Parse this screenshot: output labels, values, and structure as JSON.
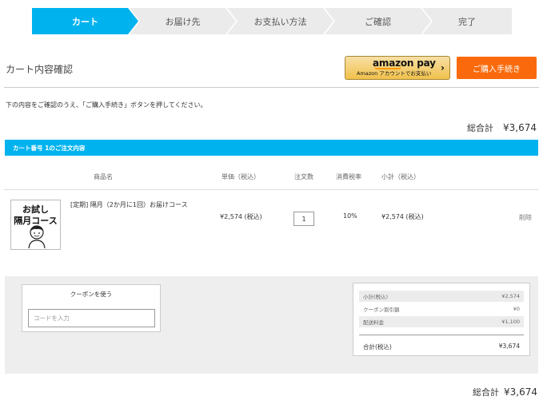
{
  "steps": [
    {
      "label": "カート",
      "active": true
    },
    {
      "label": "お届け先",
      "active": false
    },
    {
      "label": "お支払い方法",
      "active": false
    },
    {
      "label": "ご確認",
      "active": false
    },
    {
      "label": "完了",
      "active": false
    }
  ],
  "colors": {
    "step_active": "#00b3ef",
    "step_inactive": "#ebebeb",
    "checkout": "#fa6a0c",
    "cart_header": "#00b3ef"
  },
  "header": {
    "title": "カート内容確認",
    "amazon_logo": "amazon pay",
    "amazon_sub": "Amazon アカウントでお支払い",
    "amazon_arrow": "›",
    "checkout_label": "ご購入手続き"
  },
  "instruction": "下の内容をご確認のうえ、「ご購入手続き」ボタンを押してください。",
  "total_top": {
    "label": "総合計",
    "amount": "¥3,674"
  },
  "cart": {
    "header": "カート番号 1のご注文内容",
    "columns": {
      "name": "商品名",
      "unit_price": "単価（税込）",
      "qty": "注文数",
      "tax_rate": "消費税率",
      "subtotal": "小計（税込）"
    },
    "items": [
      {
        "image_line1": "お試し",
        "image_line2": "隔月コース",
        "name": "[定期] 隔月（2か月に1回）お届けコース",
        "unit_price": "¥2,574 (税込)",
        "qty": "1",
        "tax_rate": "10%",
        "subtotal": "¥2,574 (税込)",
        "delete_label": "削除"
      }
    ]
  },
  "coupon": {
    "title": "クーポンを使う",
    "placeholder": "コードを入力"
  },
  "summary": {
    "rows": [
      {
        "label": "小計(税込)",
        "value": "¥2,574"
      },
      {
        "label": "クーポン割引額",
        "value": "¥0"
      },
      {
        "label": "配送料金",
        "value": "¥1,100"
      }
    ],
    "total_label": "合計(税込)",
    "total_value": "¥3,674"
  },
  "total_bottom": {
    "label": "総合計",
    "amount": "¥3,674"
  }
}
